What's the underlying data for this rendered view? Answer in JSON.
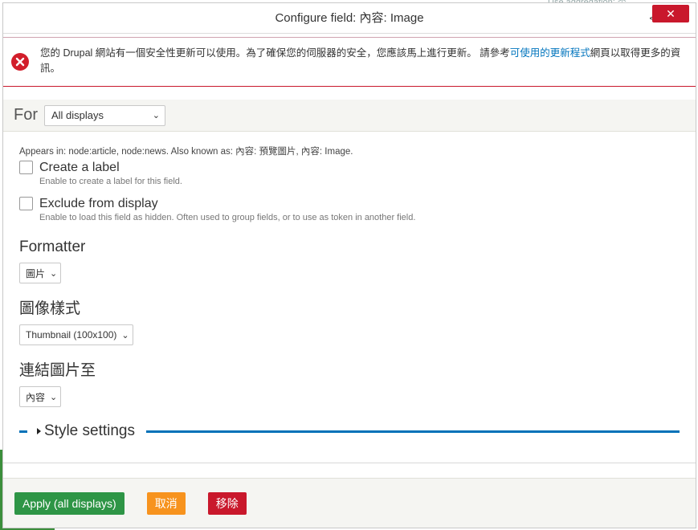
{
  "background": {
    "top_text": "Use aggregation: 否"
  },
  "dialog": {
    "title": "Configure field: 內容: Image",
    "title_arrow": "<",
    "close_label": "✕"
  },
  "alert": {
    "text_before": "您的 Drupal 網站有一個安全性更新可以使用。為了確保您的伺服器的安全，您應該馬上進行更新。 請參考",
    "link_text": "可使用的更新程式",
    "text_after": "網頁以取得更多的資訊。"
  },
  "for_bar": {
    "label": "For",
    "select_value": "All displays"
  },
  "content": {
    "appears_in": "Appears in: node:article, node:news. Also known as: 內容: 預覽圖片, 內容: Image.",
    "create_label": {
      "label": "Create a label",
      "description": "Enable to create a label for this field."
    },
    "exclude": {
      "label": "Exclude from display",
      "description": "Enable to load this field as hidden. Often used to group fields, or to use as token in another field."
    },
    "formatter": {
      "title": "Formatter",
      "value": "圖片"
    },
    "image_style": {
      "title": "圖像樣式",
      "value": "Thumbnail (100x100)"
    },
    "link_to": {
      "title": "連結圖片至",
      "value": "內容"
    },
    "style_settings": "Style settings"
  },
  "footer": {
    "apply": "Apply (all displays)",
    "cancel": "取消",
    "remove": "移除"
  },
  "colors": {
    "apply": "#2e9546",
    "cancel": "#f7931e",
    "remove": "#c9182c",
    "link": "#0074bd",
    "accent": "#0071b8"
  }
}
